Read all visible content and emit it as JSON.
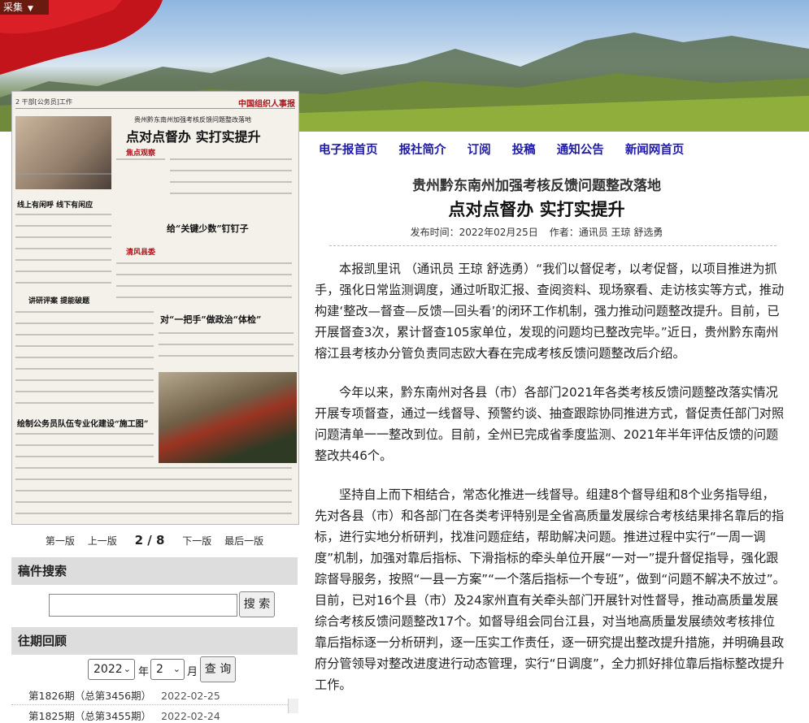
{
  "toolbar": {
    "collect_label": "采集",
    "collect_caret": "▼"
  },
  "newspaper_page": {
    "header_left": "2  干部[公务员]工作",
    "header_right": "中国组织人事报",
    "kicker": "贵州黔东南州加强考核反馈问题整改落地",
    "title": "点对点督办  实打实提升",
    "headline_2": "给“关键少数”钉钉子",
    "headline_3": "讲研评案  提能破题",
    "headline_4": "对“一把手”做政治“体检”",
    "headline_5": "绘制公务员队伍专业化建设“施工图”",
    "headline_6": "线上有闲呼  线下有闲应",
    "tag_1": "焦点观察",
    "tag_2": "清风县委"
  },
  "pager": {
    "first": "第一版",
    "prev": "上一版",
    "current": "2 / 8",
    "next": "下一版",
    "last": "最后一版"
  },
  "search": {
    "title": "稿件搜索",
    "button": "搜 索",
    "placeholder": ""
  },
  "archive": {
    "title": "往期回顾",
    "year": "2022",
    "year_unit": "年",
    "month": "2",
    "month_unit": "月",
    "query_button": "查 询",
    "issues": [
      {
        "label": "第1826期（总第3456期）",
        "date": "2022-02-25"
      },
      {
        "label": "第1825期（总第3455期）",
        "date": "2022-02-24"
      }
    ]
  },
  "nav": [
    "电子报首页",
    "报社简介",
    "订阅",
    "投稿",
    "通知公告",
    "新闻网首页"
  ],
  "article": {
    "kicker": "贵州黔东南州加强考核反馈问题整改落地",
    "title": "点对点督办 实打实提升",
    "meta_date": "发布时间：2022年02月25日",
    "meta_author": "作者：通讯员 王琼 舒选勇",
    "paragraphs": [
      "本报凯里讯 （通讯员 王琼 舒选勇）“我们以督促考，以考促督，以项目推进为抓手，强化日常监测调度，通过听取汇报、查阅资料、现场察看、走访核实等方式，推动构建‘整改—督查—反馈—回头看’的闭环工作机制，强力推动问题整改提升。目前，已开展督查3次，累计督查105家单位，发现的问题均已整改完毕。”近日，贵州黔东南州榕江县考核办分管负责同志欧大春在完成考核反馈问题整改后介绍。",
      "今年以来，黔东南州对各县（市）各部门2021年各类考核反馈问题整改落实情况开展专项督查，通过一线督导、预警约谈、抽查跟踪协同推进方式，督促责任部门对照问题清单一一整改到位。目前，全州已完成省季度监测、2021年半年评估反馈的问题整改共46个。",
      "坚持自上而下相结合，常态化推进一线督导。组建8个督导组和8个业务指导组，先对各县（市）和各部门在各类考评特别是全省高质量发展综合考核结果排名靠后的指标，进行实地分析研判，找准问题症结，帮助解决问题。推进过程中实行“一周一调度”机制，加强对靠后指标、下滑指标的牵头单位开展“一对一”提升督促指导，强化跟踪督导服务，按照“一县一方案”“一个落后指标一个专班”，做到“问题不解决不放过”。目前，已对16个县（市）及24家州直有关牵头部门开展针对性督导，推动高质量发展综合考核反馈问题整改17个。如督导组会同台江县，对当地高质量发展绩效考核排位靠后指标逐一分析研判，逐一压实工作责任，逐一研究提出整改提升措施，并明确县政府分管领导对整改进度进行动态管理，实行“日调度”，全力抓好排位靠后指标整改提升工作。"
    ]
  }
}
